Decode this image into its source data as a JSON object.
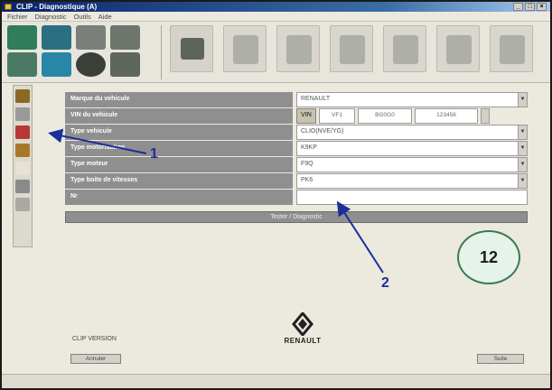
{
  "window": {
    "title": "CLIP - Diagnostique (A)"
  },
  "menu": [
    "Fichier",
    "Diagnostic",
    "Outils",
    "Aide"
  ],
  "form": {
    "rows": [
      {
        "label": "Marque du vehicule",
        "value": "RENAULT",
        "type": "select"
      },
      {
        "label": "VIN du vehicule",
        "type": "vin",
        "button": "VIN",
        "segments": [
          "VF1",
          "BG0G0",
          "123456"
        ]
      },
      {
        "label": "Type vehicule",
        "value": "CLIO(NVE/YG)",
        "type": "select"
      },
      {
        "label": "Type motorisation",
        "value": "K9KP",
        "type": "select"
      },
      {
        "label": "Type moteur",
        "value": "F9Q",
        "type": "select"
      },
      {
        "label": "Type boite de vitesses",
        "value": "PK6",
        "type": "select"
      },
      {
        "label": "Nr",
        "value": "",
        "type": "text"
      }
    ],
    "action_label": "Tester / Diagnostic"
  },
  "badge": "12",
  "annotations": {
    "one": "1",
    "two": "2"
  },
  "version_text": "CLIP VERSION",
  "logo_text": "RENAULT",
  "bottom_left_button": "Annuler",
  "bottom_right_button": "Suite"
}
